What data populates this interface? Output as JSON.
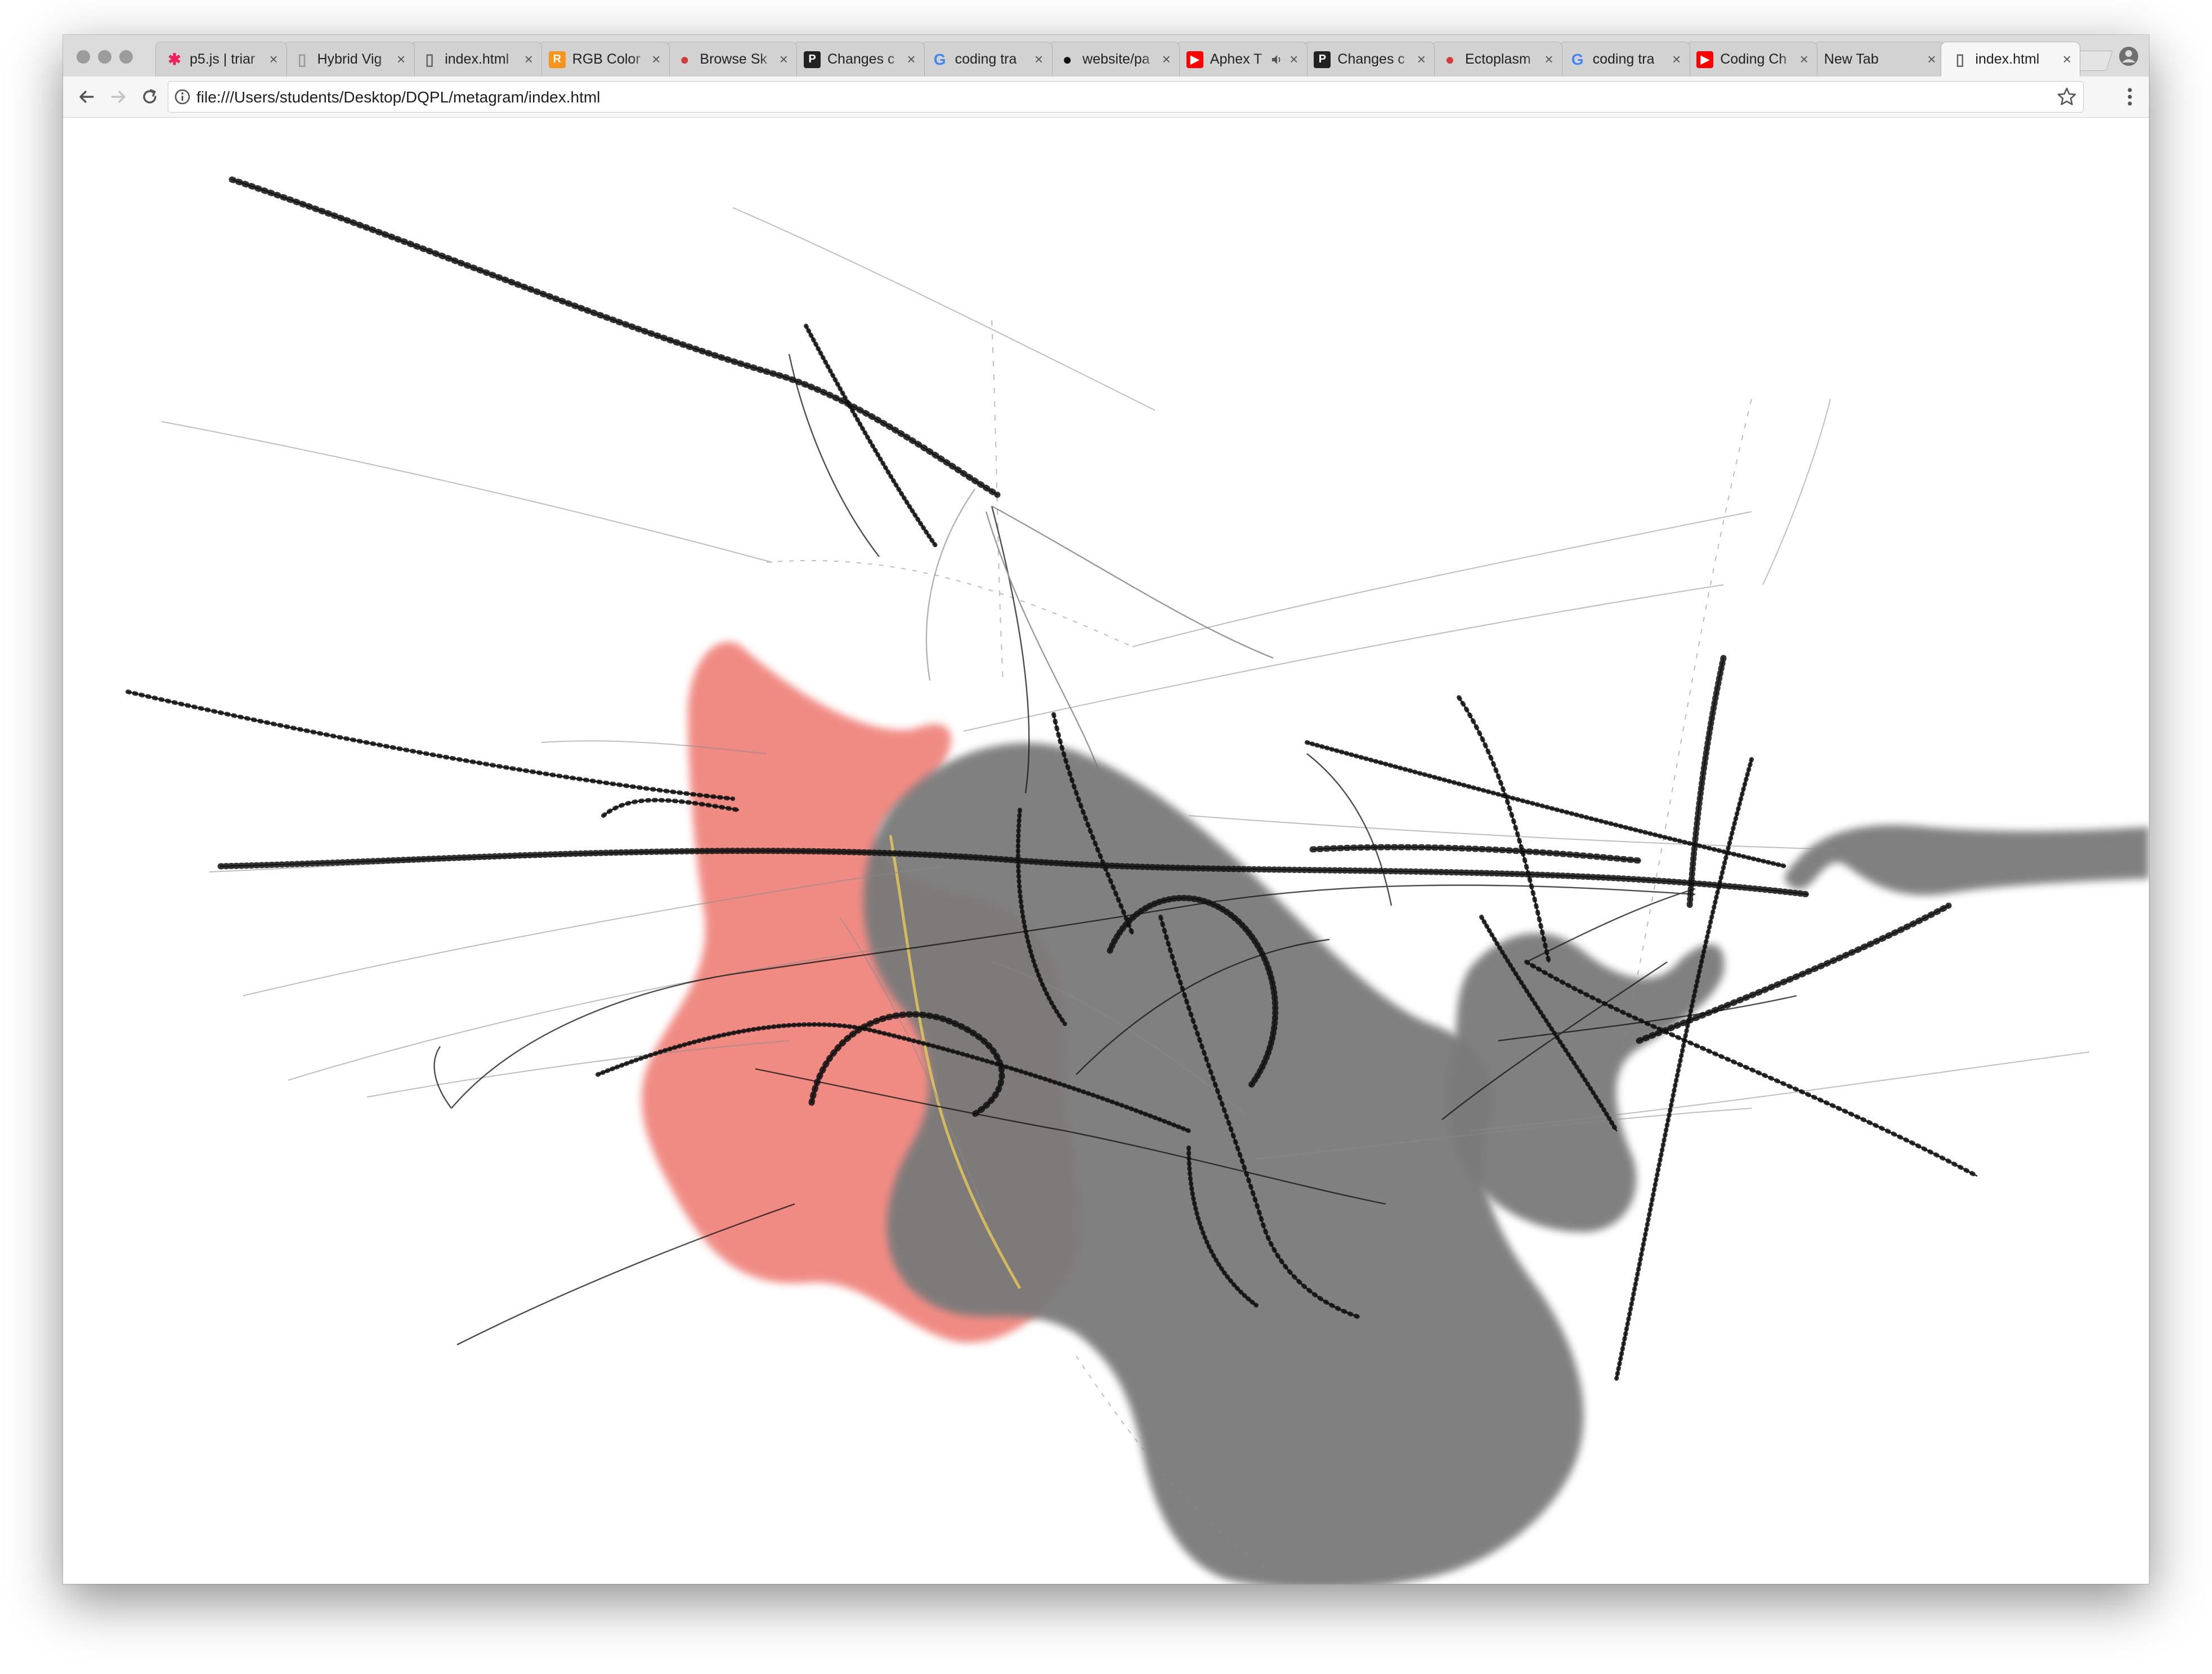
{
  "browser": {
    "tabs": [
      {
        "title": "p5.js | triar",
        "favicon": "p5-asterisk-icon",
        "favicon_color": "#ed225d"
      },
      {
        "title": "Hybrid Vig",
        "favicon": "page-icon",
        "favicon_color": "#9a9a9a"
      },
      {
        "title": "index.html",
        "favicon": "document-icon",
        "favicon_color": "#666666"
      },
      {
        "title": "RGB Color",
        "favicon": "r-logo-icon",
        "favicon_color": "#f7941d"
      },
      {
        "title": "Browse Sk",
        "favicon": "sketch-globe-icon",
        "favicon_color": "#d23b3b"
      },
      {
        "title": "Changes c",
        "favicon": "p-logo-icon",
        "favicon_color": "#222222"
      },
      {
        "title": "coding tra",
        "favicon": "google-icon",
        "favicon_color": "#4285f4"
      },
      {
        "title": "website/pa",
        "favicon": "github-icon",
        "favicon_color": "#111111"
      },
      {
        "title": "Aphex T",
        "favicon": "youtube-icon",
        "favicon_color": "#ff0000",
        "audio": "speaker-icon"
      },
      {
        "title": "Changes c",
        "favicon": "p-logo-icon",
        "favicon_color": "#222222"
      },
      {
        "title": "Ectoplasm",
        "favicon": "sketch-globe-icon",
        "favicon_color": "#d23b3b"
      },
      {
        "title": "coding tra",
        "favicon": "google-icon",
        "favicon_color": "#4285f4"
      },
      {
        "title": "Coding Ch",
        "favicon": "youtube-icon",
        "favicon_color": "#ff0000"
      },
      {
        "title": "New Tab",
        "favicon": "",
        "favicon_color": ""
      },
      {
        "title": "index.html",
        "favicon": "document-icon",
        "favicon_color": "#666666",
        "active": true
      }
    ],
    "close_glyph": "×",
    "url": "file:///Users/students/Desktop/DQPL/metagram/index.html"
  },
  "sketch": {
    "colors": {
      "salmon": "#ef827a",
      "gray": "#7a7a7a",
      "stroke": "#111111",
      "yellow_stroke": "#e3c65a"
    }
  }
}
